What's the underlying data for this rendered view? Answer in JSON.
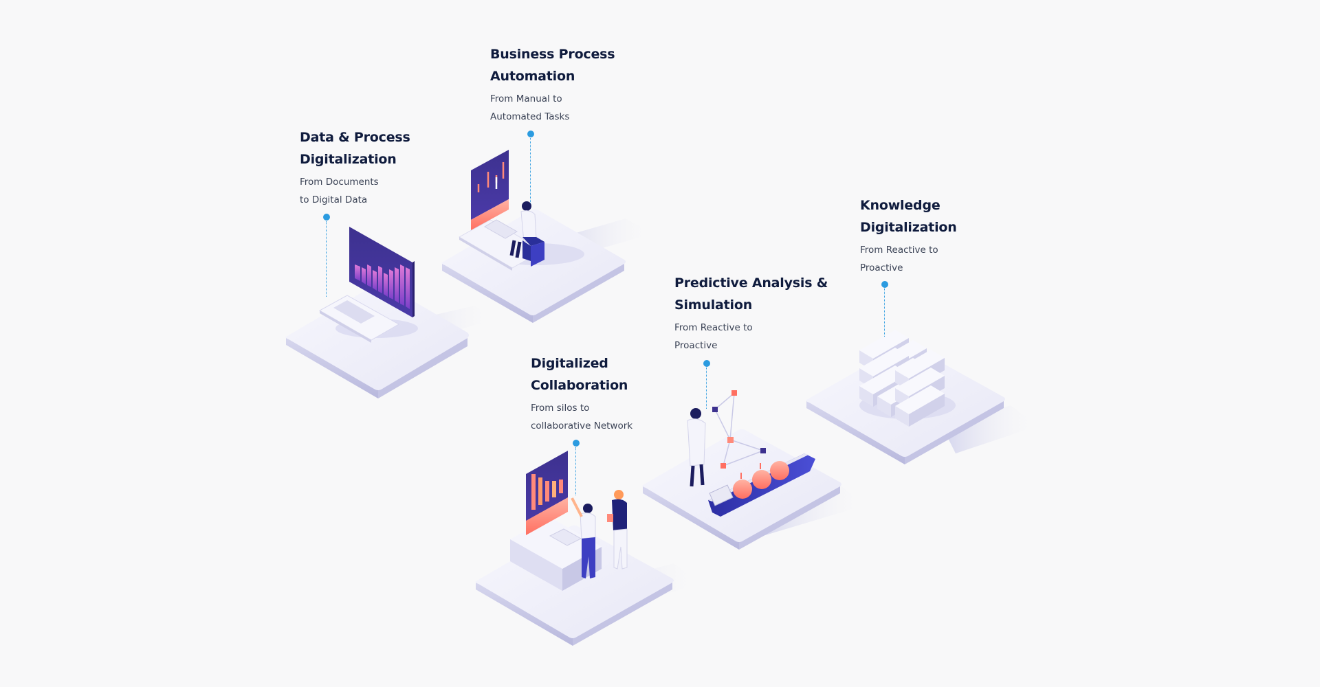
{
  "colors": {
    "background": "#f8f8f9",
    "title": "#0f1b3d",
    "subtitle": "#3a4255",
    "connector": "#2b9be0",
    "platform_top": "#f3f3fb",
    "platform_side": "#c9c9e6",
    "screen_dark": "#3b2f8f",
    "accent_coral": "#ff8a7a",
    "accent_purple": "#9b59d9"
  },
  "stages": [
    {
      "id": "data-process",
      "title": "Data & Process\nDigitalization",
      "subtitle": "From Documents\nto Digital Data",
      "icon": "laptop-icon"
    },
    {
      "id": "bpa",
      "title": "Business Process\nAutomation",
      "subtitle": "From Manual to\nAutomated Tasks",
      "icon": "workstation-icon"
    },
    {
      "id": "collaboration",
      "title": "Digitalized\nCollaboration",
      "subtitle": "From silos to\ncollaborative Network",
      "icon": "team-meeting-icon"
    },
    {
      "id": "predictive",
      "title": "Predictive Analysis &\nSimulation",
      "subtitle": "From Reactive to\nProactive",
      "icon": "ship-network-icon"
    },
    {
      "id": "knowledge",
      "title": "Knowledge\nDigitalization",
      "subtitle": "From Reactive to\nProactive",
      "icon": "blocks-icon"
    }
  ]
}
